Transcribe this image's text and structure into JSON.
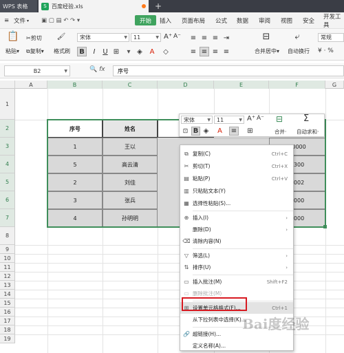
{
  "titlebar": {
    "app_tab": "WPS 表格",
    "file_tab": "百度经验.xls"
  },
  "menubar": {
    "file": "文件",
    "start": "开始",
    "items": [
      "插入",
      "页面布局",
      "公式",
      "数据",
      "审阅",
      "视图",
      "安全",
      "开发工具"
    ]
  },
  "ribbon": {
    "cut": "剪切",
    "paste": "粘贴",
    "copy": "复制",
    "format_painter": "格式刷",
    "font_name": "宋体",
    "font_size": "11",
    "merge_center": "合并居中",
    "auto_wrap": "自动换行",
    "number_format": "常规"
  },
  "formula_bar": {
    "name_box": "B2",
    "fx": "fx",
    "content": "序号"
  },
  "grid": {
    "columns": [
      "A",
      "B",
      "C",
      "D",
      "E",
      "F",
      "G"
    ],
    "rows": [
      "1",
      "2",
      "3",
      "4",
      "5",
      "6",
      "7",
      "8",
      "9",
      "10",
      "11",
      "12",
      "13",
      "14",
      "15",
      "16",
      "17",
      "18",
      "19"
    ],
    "header_row": [
      "序号",
      "姓名"
    ],
    "data": [
      {
        "no": "1",
        "name": "王以",
        "f": "40000",
        "e": "00"
      },
      {
        "no": "5",
        "name": "高云清",
        "f": "2300"
      },
      {
        "no": "2",
        "name": "刘佳",
        "f": "0002"
      },
      {
        "no": "3",
        "name": "张兵",
        "f": "0000"
      },
      {
        "no": "4",
        "name": "孙明明",
        "f": "4000"
      }
    ]
  },
  "mini_toolbar": {
    "font_name": "宋体",
    "font_size": "11",
    "merge": "合并·",
    "autosum": "自动求和·"
  },
  "context_menu": [
    {
      "label": "复制(C)",
      "shortcut": "Ctrl+C",
      "icon": "copy-icon"
    },
    {
      "label": "剪切(T)",
      "shortcut": "Ctrl+X",
      "icon": "scissors-icon"
    },
    {
      "label": "粘贴(P)",
      "shortcut": "Ctrl+V",
      "icon": "paste-icon"
    },
    {
      "label": "只粘贴文本(Y)",
      "shortcut": "",
      "icon": "paste-text-icon"
    },
    {
      "label": "选择性粘贴(S)...",
      "shortcut": "",
      "icon": "paste-special-icon"
    },
    {
      "label": "插入(I)",
      "shortcut": "",
      "icon": "insert-icon",
      "submenu": true
    },
    {
      "label": "删除(D)",
      "shortcut": "",
      "icon": "",
      "submenu": true
    },
    {
      "label": "清除内容(N)",
      "shortcut": "",
      "icon": "eraser-icon"
    },
    {
      "label": "筛选(L)",
      "shortcut": "",
      "icon": "filter-icon",
      "submenu": true
    },
    {
      "label": "排序(U)",
      "shortcut": "",
      "icon": "sort-icon",
      "submenu": true
    },
    {
      "label": "插入批注(M)",
      "shortcut": "Shift+F2",
      "icon": "comment-icon"
    },
    {
      "label": "删除批注(M)",
      "shortcut": "",
      "icon": "delete-comment-icon",
      "disabled": true
    },
    {
      "label": "设置单元格格式(F)...",
      "shortcut": "Ctrl+1",
      "icon": "format-cells-icon",
      "highlighted": true
    },
    {
      "label": "从下拉列表中选择(K)...",
      "shortcut": "",
      "icon": ""
    },
    {
      "label": "超链接(H)...",
      "shortcut": "",
      "icon": "link-icon"
    },
    {
      "label": "定义名称(A)...",
      "shortcut": "",
      "icon": ""
    }
  ],
  "watermark": "Bai度经验"
}
